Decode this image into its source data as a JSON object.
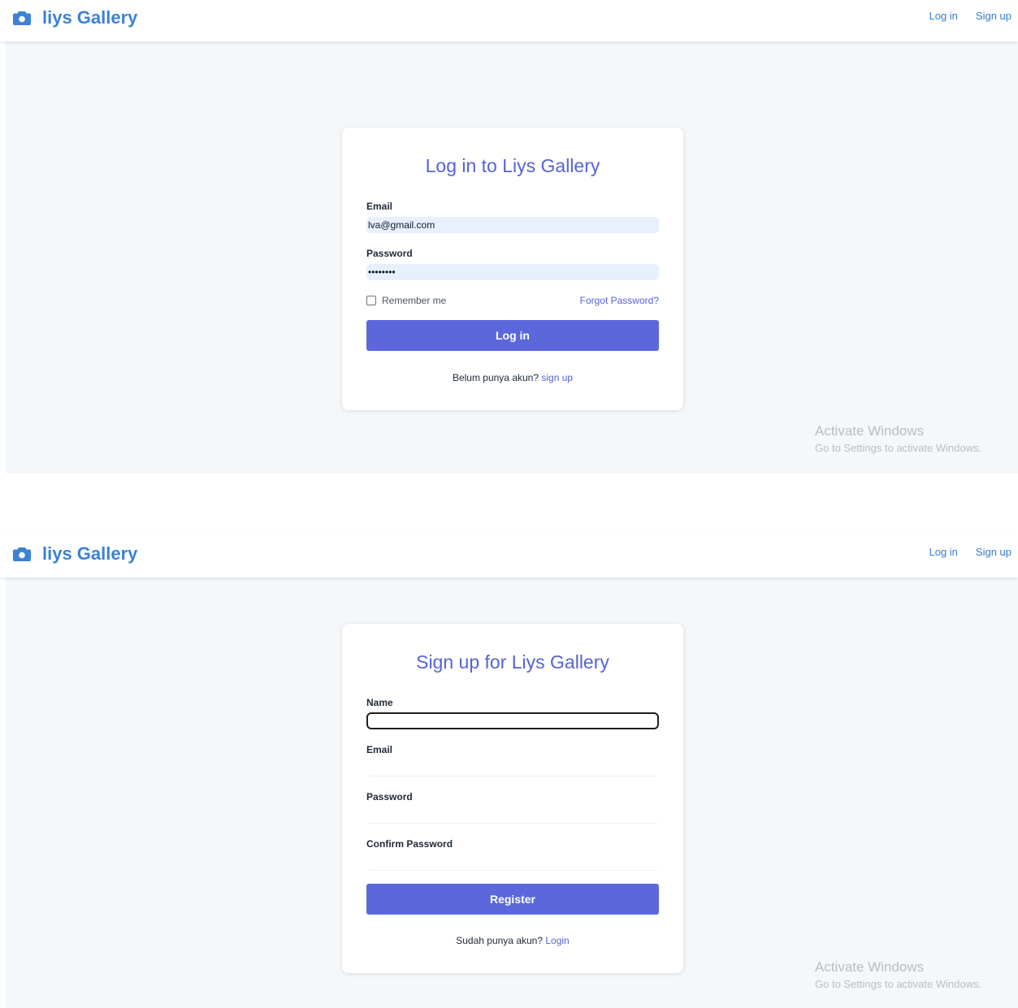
{
  "navbar": {
    "brand": "liys Gallery",
    "brand_icon": "camera-icon",
    "links": [
      "Log in",
      "Sign up"
    ],
    "brand_color": "#3b82d6"
  },
  "login": {
    "title": "Log in to Liys Gallery",
    "email_label": "Email",
    "email_value": "lva@gmail.com",
    "password_label": "Password",
    "password_value": "password",
    "remember_label": "Remember me",
    "forgot_label": "Forgot Password?",
    "submit_label": "Log in",
    "footer_text": "Belum punya akun?",
    "footer_link": "sign up"
  },
  "register": {
    "title": "Sign up for Liys Gallery",
    "name_label": "Name",
    "name_value": "",
    "email_label": "Email",
    "email_value": "",
    "password_label": "Password",
    "password_value": "",
    "confirm_label": "Confirm Password",
    "confirm_value": "",
    "submit_label": "Register",
    "footer_text": "Sudah punya akun?",
    "footer_link": "Login"
  },
  "watermark": {
    "title": "Activate Windows",
    "subtitle": "Go to Settings to activate Windows."
  },
  "colors": {
    "accent": "#5b67da",
    "title": "#5563d6",
    "background": "#f5f8fb",
    "autofill": "#e8f0fe"
  }
}
